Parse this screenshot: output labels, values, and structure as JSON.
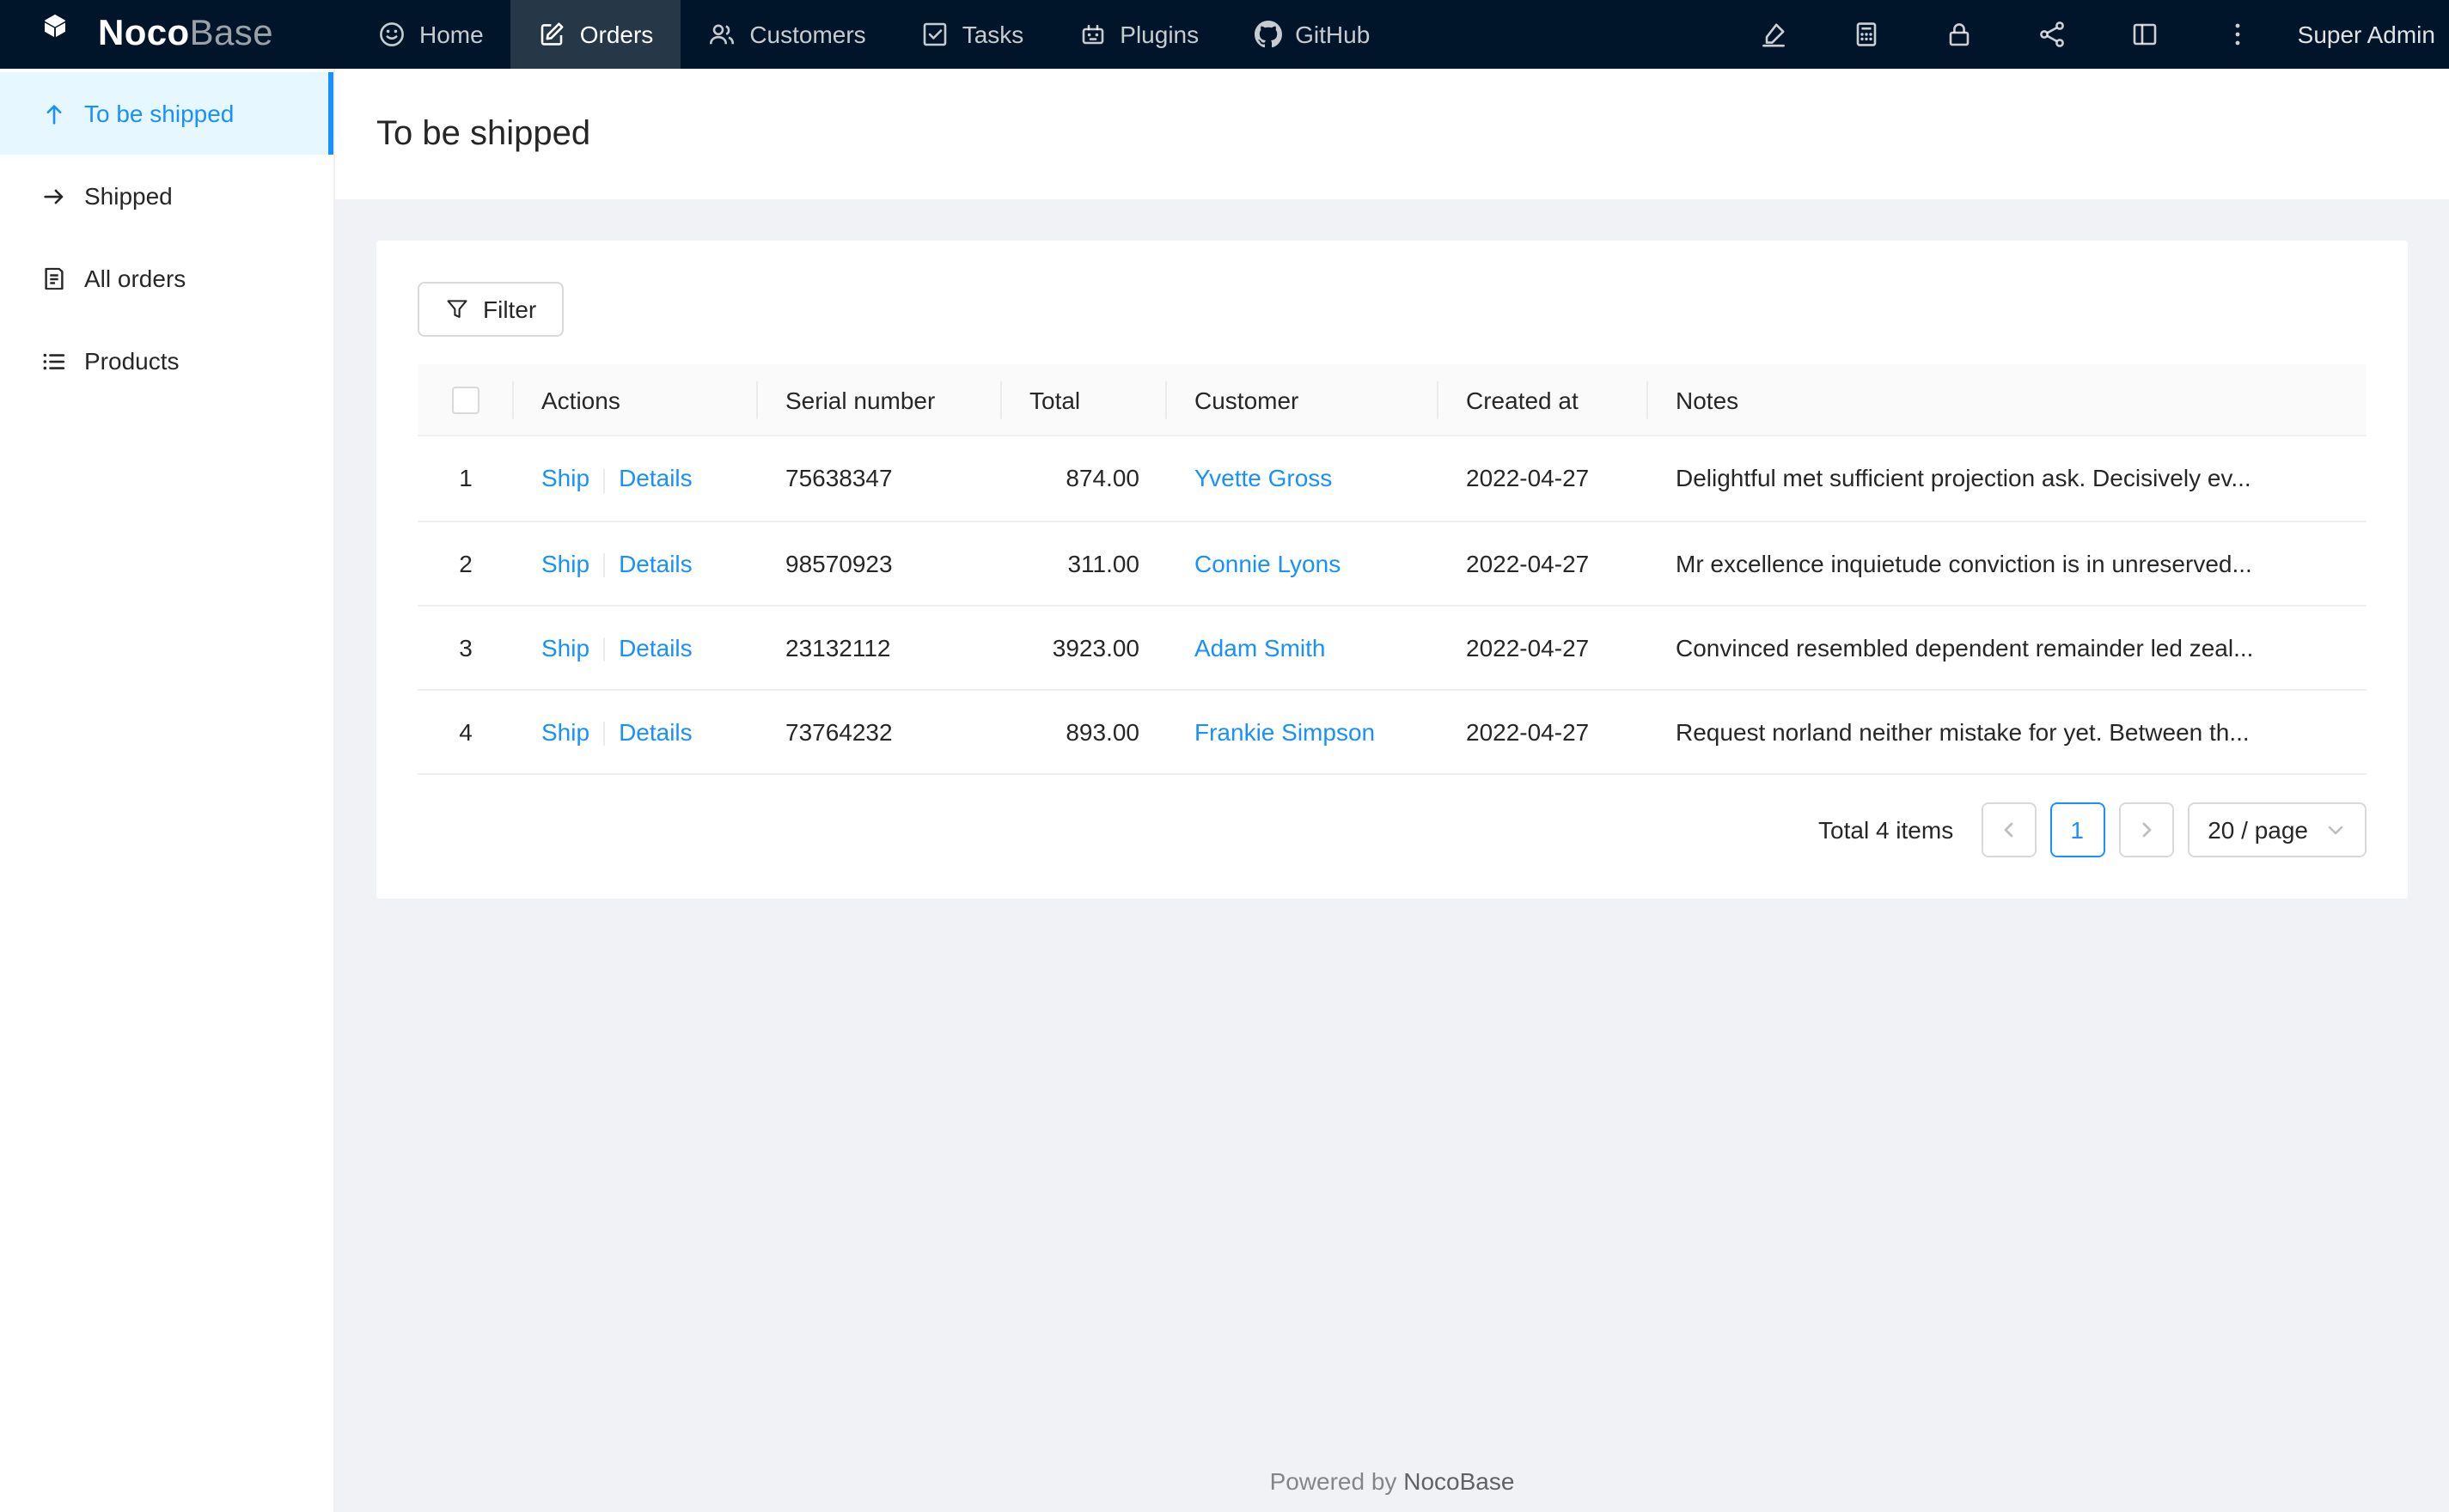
{
  "navbar": {
    "logo_noco": "Noco",
    "logo_base": "Base",
    "items": [
      {
        "label": "Home",
        "icon": "home-icon",
        "active": false
      },
      {
        "label": "Orders",
        "icon": "orders-icon",
        "active": true
      },
      {
        "label": "Customers",
        "icon": "customers-icon",
        "active": false
      },
      {
        "label": "Tasks",
        "icon": "tasks-icon",
        "active": false
      },
      {
        "label": "Plugins",
        "icon": "plugins-icon",
        "active": false
      },
      {
        "label": "GitHub",
        "icon": "github-icon",
        "active": false
      }
    ],
    "right_icons": [
      "highlighter-icon",
      "calculator-icon",
      "lock-icon",
      "api-icon",
      "layout-icon",
      "more-icon"
    ],
    "user_label": "Super Admin"
  },
  "sidebar": {
    "items": [
      {
        "label": "To be shipped",
        "icon": "arrow-up-icon",
        "active": true
      },
      {
        "label": "Shipped",
        "icon": "arrow-right-icon",
        "active": false
      },
      {
        "label": "All orders",
        "icon": "audit-icon",
        "active": false
      },
      {
        "label": "Products",
        "icon": "list-icon",
        "active": false
      }
    ]
  },
  "page_title": "To be shipped",
  "toolbar": {
    "filter_label": "Filter"
  },
  "table": {
    "columns": {
      "actions": "Actions",
      "serial": "Serial number",
      "total": "Total",
      "customer": "Customer",
      "created_at": "Created at",
      "notes": "Notes"
    },
    "rows": [
      {
        "index": "1",
        "actions": [
          "Ship",
          "Details"
        ],
        "serial": "75638347",
        "total": "874.00",
        "customer": "Yvette Gross",
        "created_at": "2022-04-27",
        "notes": "Delightful met sufficient projection ask. Decisively ev..."
      },
      {
        "index": "2",
        "actions": [
          "Ship",
          "Details"
        ],
        "serial": "98570923",
        "total": "311.00",
        "customer": "Connie Lyons",
        "created_at": "2022-04-27",
        "notes": "Mr excellence inquietude conviction is in unreserved..."
      },
      {
        "index": "3",
        "actions": [
          "Ship",
          "Details"
        ],
        "serial": "23132112",
        "total": "3923.00",
        "customer": "Adam Smith",
        "created_at": "2022-04-27",
        "notes": "Convinced resembled dependent remainder led zeal..."
      },
      {
        "index": "4",
        "actions": [
          "Ship",
          "Details"
        ],
        "serial": "73764232",
        "total": "893.00",
        "customer": "Frankie Simpson",
        "created_at": "2022-04-27",
        "notes": "Request norland neither mistake for yet. Between th..."
      }
    ]
  },
  "pagination": {
    "total_text": "Total 4 items",
    "page": "1",
    "page_size": "20 / page"
  },
  "footer": {
    "prefix": "Powered by ",
    "brand": "NocoBase"
  },
  "colors": {
    "primary": "#1890ff",
    "navbar_bg": "#001529",
    "navbar_active_bg": "rgba(255,255,255,0.15)",
    "sidebar_active_bg": "#e6f7ff",
    "content_bg": "#f0f2f5",
    "link": "#1890ff"
  }
}
